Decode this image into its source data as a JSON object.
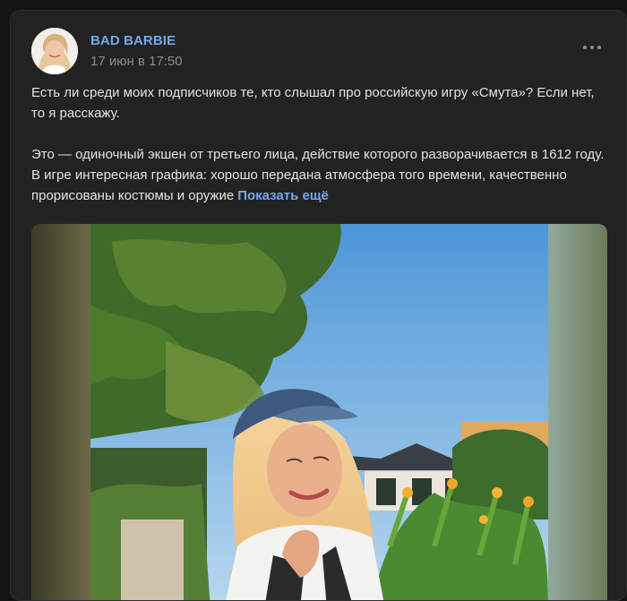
{
  "post": {
    "author": "BAD BARBIE",
    "date": "17 июн в 17:50",
    "paragraphs": [
      "Есть ли среди моих подписчиков те, кто слышал про российскую игру «Смута»? Если нет, то я расскажу.",
      "Это — одиночный экшен от третьего лица, действие которого разворачивается в 1612 году. В игре интересная графика: хорошо передана атмосфера того времени, качественно прорисованы костюмы и оружие"
    ],
    "show_more_label": "Показать ещё",
    "more_icon": "more-dots-icon"
  },
  "colors": {
    "background": "#141414",
    "card": "#222222",
    "link": "#71aaeb",
    "text": "#e1e3e6",
    "muted": "#8e8e8e"
  }
}
